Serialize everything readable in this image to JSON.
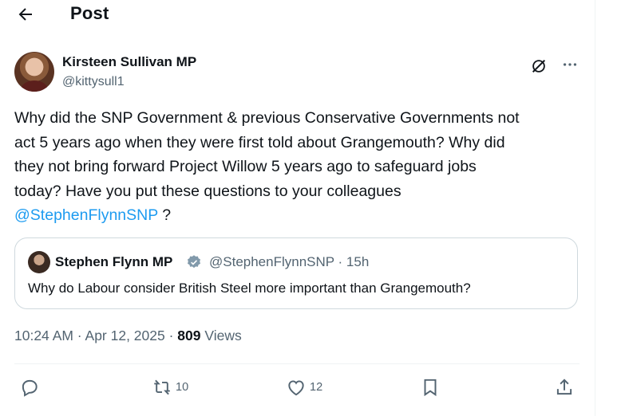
{
  "header": {
    "title": "Post"
  },
  "post": {
    "author_name": "Kirsteen Sullivan MP",
    "author_handle": "@kittysull1",
    "text_lines": [
      "Why did the SNP Government & previous Conservative Governments not",
      "act 5 years ago when they were first told  about Grangemouth? Why did",
      "they not bring forward Project Willow 5 years ago to safeguard jobs",
      "today? Have you put these questions to your colleagues"
    ],
    "mention": "@StephenFlynnSNP",
    "text_tail": " ?",
    "timestamp": "10:24 AM · Apr 12, 2025 · ",
    "views_count": "809",
    "views_label": " Views"
  },
  "quote": {
    "author_name": "Stephen Flynn MP",
    "author_handle_time": "@StephenFlynnSNP · 15h",
    "text": "Why do Labour consider British Steel more important than Grangemouth?"
  },
  "actions": {
    "retweets": "10",
    "likes": "12"
  },
  "colors": {
    "accent": "#1d9bf0",
    "muted": "#536471",
    "text": "#0f1419"
  },
  "icons": [
    "back-arrow-icon",
    "grok-icon",
    "more-icon",
    "verified-badge-icon",
    "reply-icon",
    "retweet-icon",
    "like-icon",
    "bookmark-icon",
    "share-icon"
  ]
}
